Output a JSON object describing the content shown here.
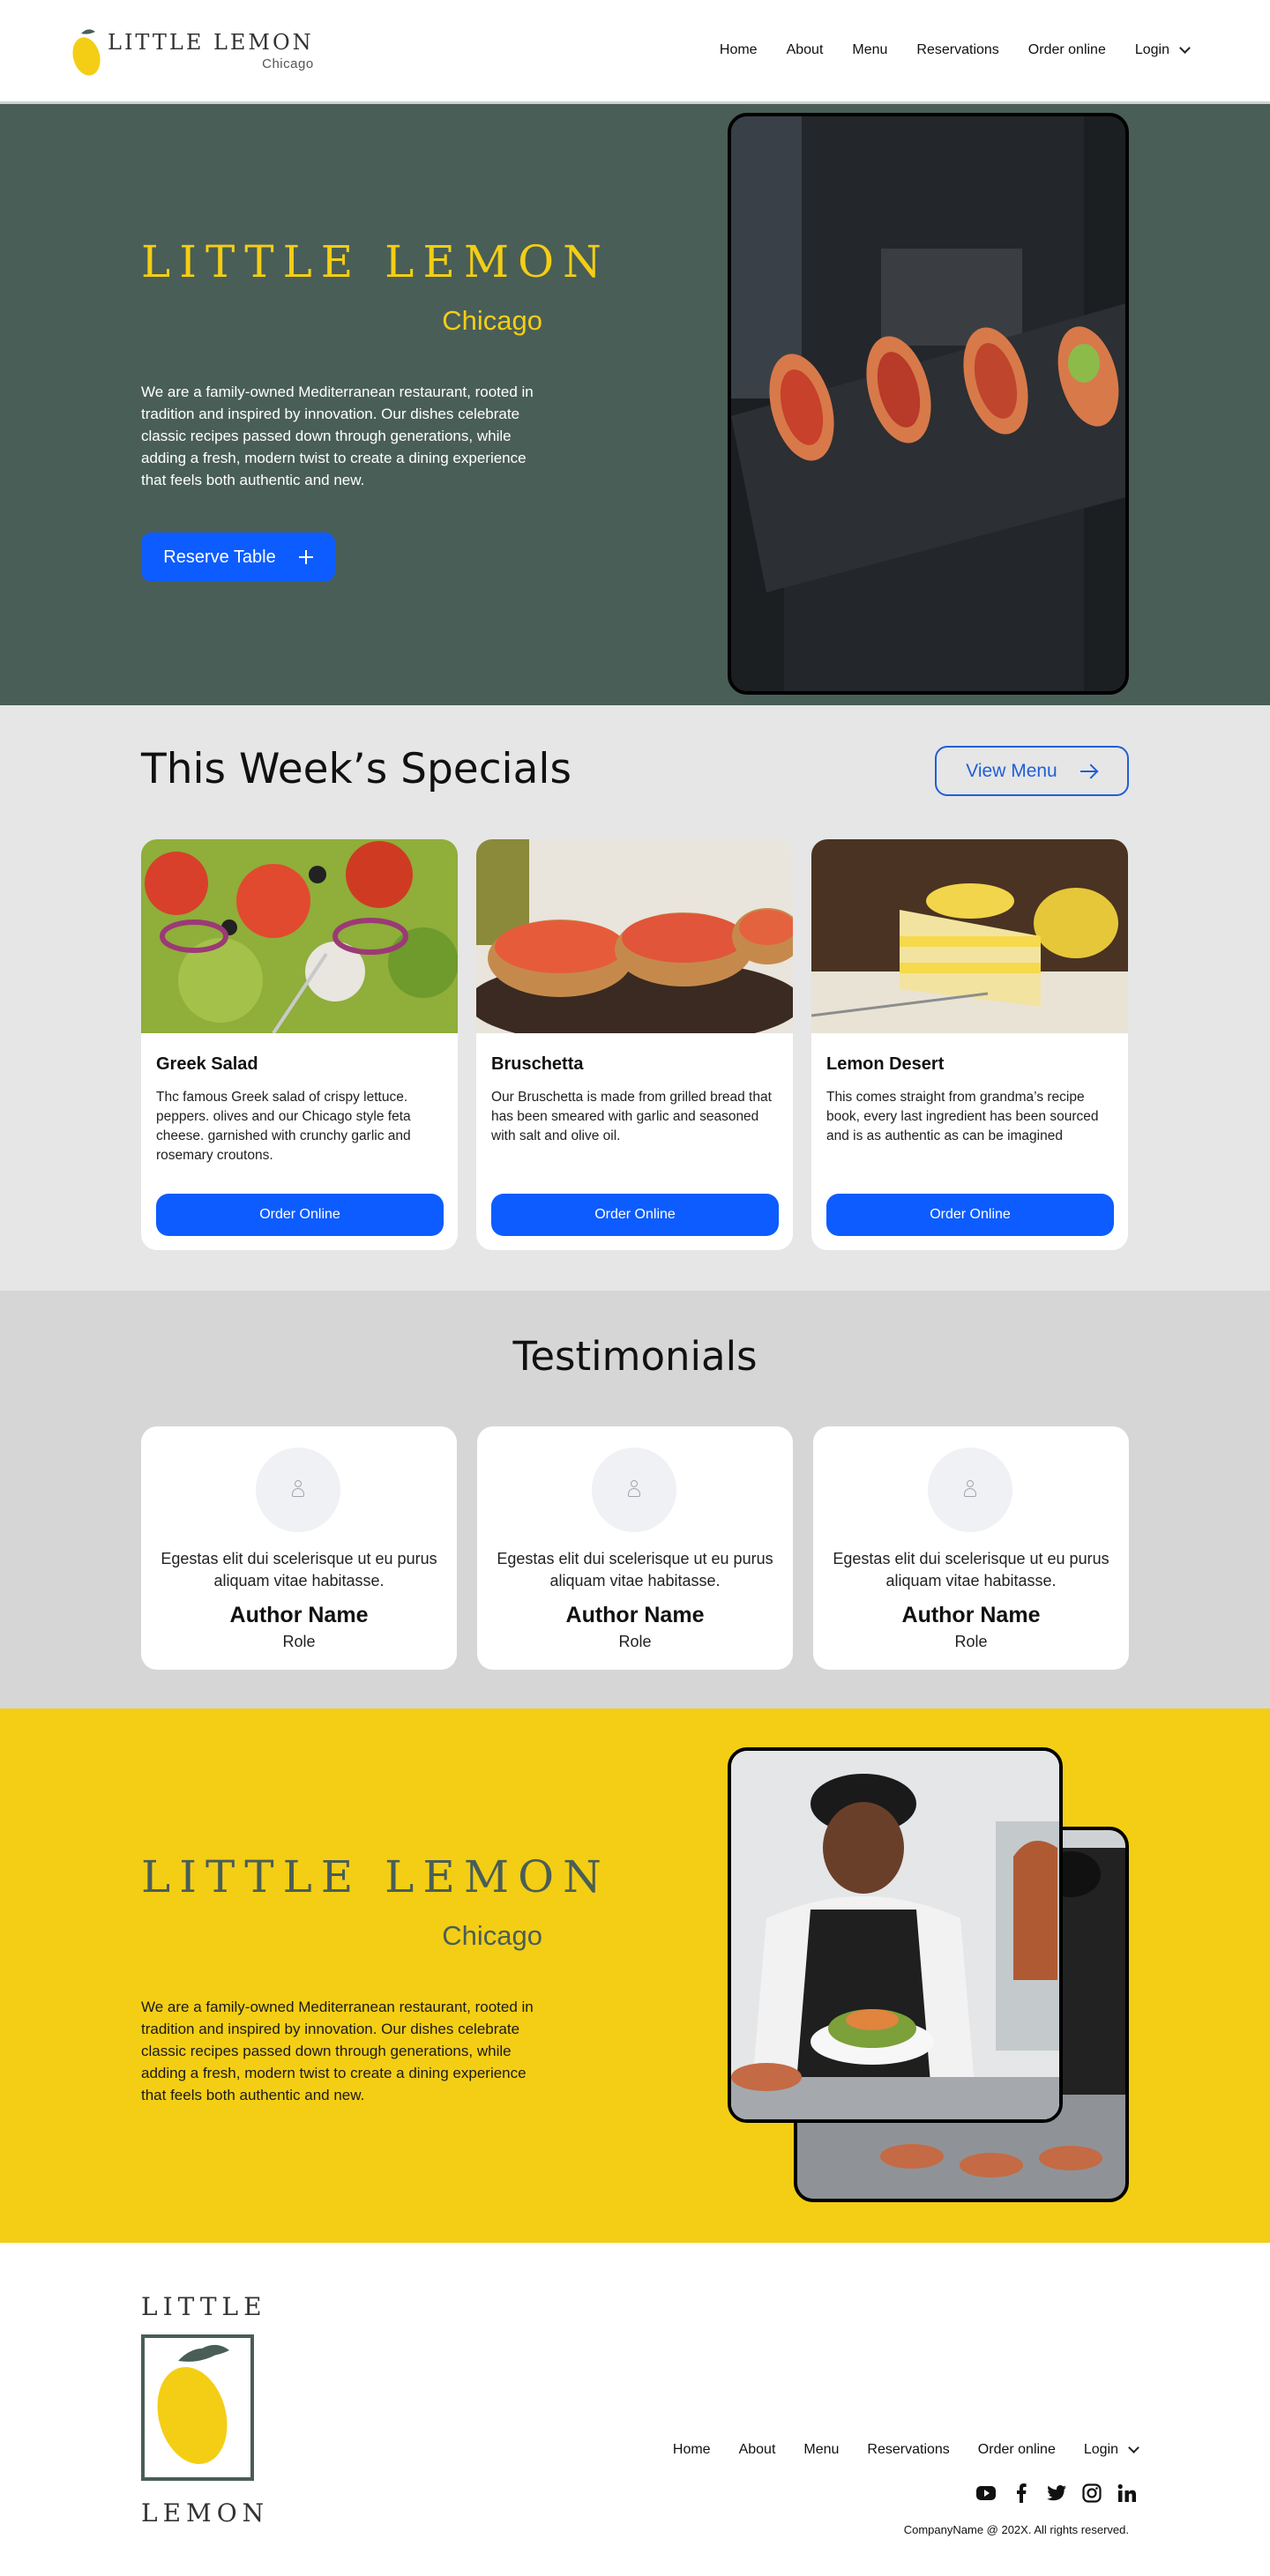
{
  "header": {
    "logo_title": "LITTLE LEMON",
    "logo_sub": "Chicago",
    "nav": [
      "Home",
      "About",
      "Menu",
      "Reservations",
      "Order online"
    ],
    "login": "Login"
  },
  "hero": {
    "title": "LITTLE LEMON",
    "city": "Chicago",
    "description": "We are a family-owned Mediterranean restaurant, rooted in tradition and inspired by innovation. Our dishes celebrate classic recipes passed down through generations, while adding a fresh, modern twist to create a dining experience that feels both authentic and new.",
    "button": "Reserve Table"
  },
  "specials": {
    "title": "This Week’s Specials",
    "menu_button": "View Menu",
    "items": [
      {
        "name": "Greek Salad",
        "description": "Thc famous Greek salad of crispy lettuce. peppers. olives and our Chicago style feta cheese. garnished with crunchy garlic and rosemary croutons.",
        "button": "Order Online"
      },
      {
        "name": "Bruschetta",
        "description": "Our Bruschetta is made from grilled bread that has been smeared with garlic and seasoned with salt and olive oil.",
        "button": "Order Online"
      },
      {
        "name": "Lemon Desert",
        "description": "This comes straight from grandma’s recipe book, every last ingredient has been sourced and is as authentic as can be imagined",
        "button": "Order Online"
      }
    ]
  },
  "testimonials": {
    "title": "Testimonials",
    "items": [
      {
        "quote": "Egestas elit dui scelerisque ut eu purus aliquam vitae habitasse.",
        "author": "Author Name",
        "role": "Role"
      },
      {
        "quote": "Egestas elit dui scelerisque ut eu purus aliquam vitae habitasse.",
        "author": "Author Name",
        "role": "Role"
      },
      {
        "quote": "Egestas elit dui scelerisque ut eu purus aliquam vitae habitasse.",
        "author": "Author Name",
        "role": "Role"
      }
    ]
  },
  "about": {
    "title": "LITTLE LEMON",
    "city": "Chicago",
    "description": "We are a family-owned Mediterranean restaurant, rooted in tradition and inspired by innovation. Our dishes celebrate classic recipes passed down through generations, while adding a fresh, modern twist to create a dining experience that feels both authentic and new."
  },
  "footer": {
    "logo_top": "LITTLE",
    "logo_bottom": "LEMON",
    "nav": [
      "Home",
      "About",
      "Menu",
      "Reservations",
      "Order online"
    ],
    "login": "Login",
    "socials": [
      "youtube-icon",
      "facebook-icon",
      "twitter-icon",
      "instagram-icon",
      "linkedin-icon"
    ],
    "copyright": "CompanyName @ 202X. All rights reserved."
  },
  "colors": {
    "primary_green": "#495e57",
    "lemon_yellow": "#f4ce14",
    "button_blue": "#0d5cff",
    "light_gray": "#e6e6e6",
    "mid_gray": "#d6d6d6"
  }
}
